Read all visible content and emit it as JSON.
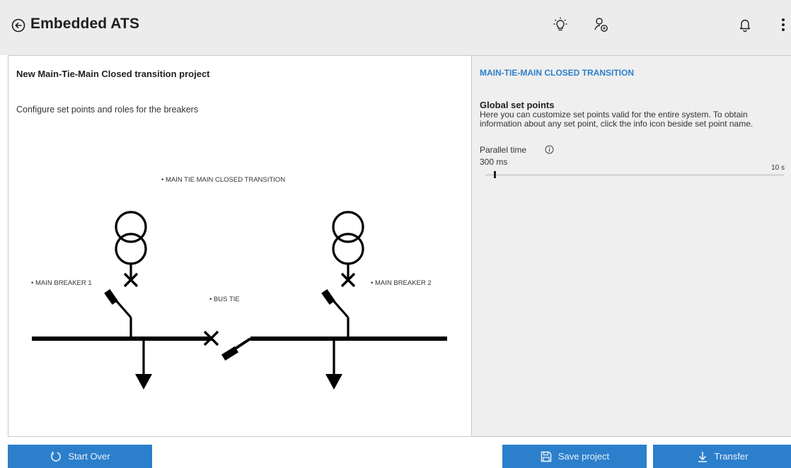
{
  "header": {
    "title": "Embedded ATS"
  },
  "left": {
    "project_title": "New Main-Tie-Main Closed transition project",
    "subtitle": "Configure set points and roles for the breakers",
    "labels": {
      "topology": "• MAIN TIE MAIN CLOSED TRANSITION",
      "main_breaker_1": "• MAIN BREAKER 1",
      "bus_tie": "• BUS TIE",
      "main_breaker_2": "• MAIN BREAKER 2"
    }
  },
  "right": {
    "heading": "MAIN-TIE-MAIN CLOSED TRANSITION",
    "section_title": "Global set points",
    "section_desc": "Here you can customize set points valid for the entire system. To obtain information about any set point, click the info icon beside set point name.",
    "param_label": "Parallel time",
    "param_value": "300 ms",
    "slider_max": "10 s",
    "slider_fraction": 0.03
  },
  "buttons": {
    "start_over": "Start Over",
    "save_project": "Save project",
    "transfer": "Transfer"
  },
  "icons": [
    "back-icon",
    "lightbulb-icon",
    "user-settings-icon",
    "bell-icon",
    "more-vertical-icon",
    "info-icon",
    "restart-icon",
    "save-icon",
    "download-icon"
  ],
  "colors": {
    "accent": "#2c7fcb",
    "heading_blue": "#2f7fc9",
    "header_bg": "#ececec",
    "panel_bg": "#efefef"
  }
}
